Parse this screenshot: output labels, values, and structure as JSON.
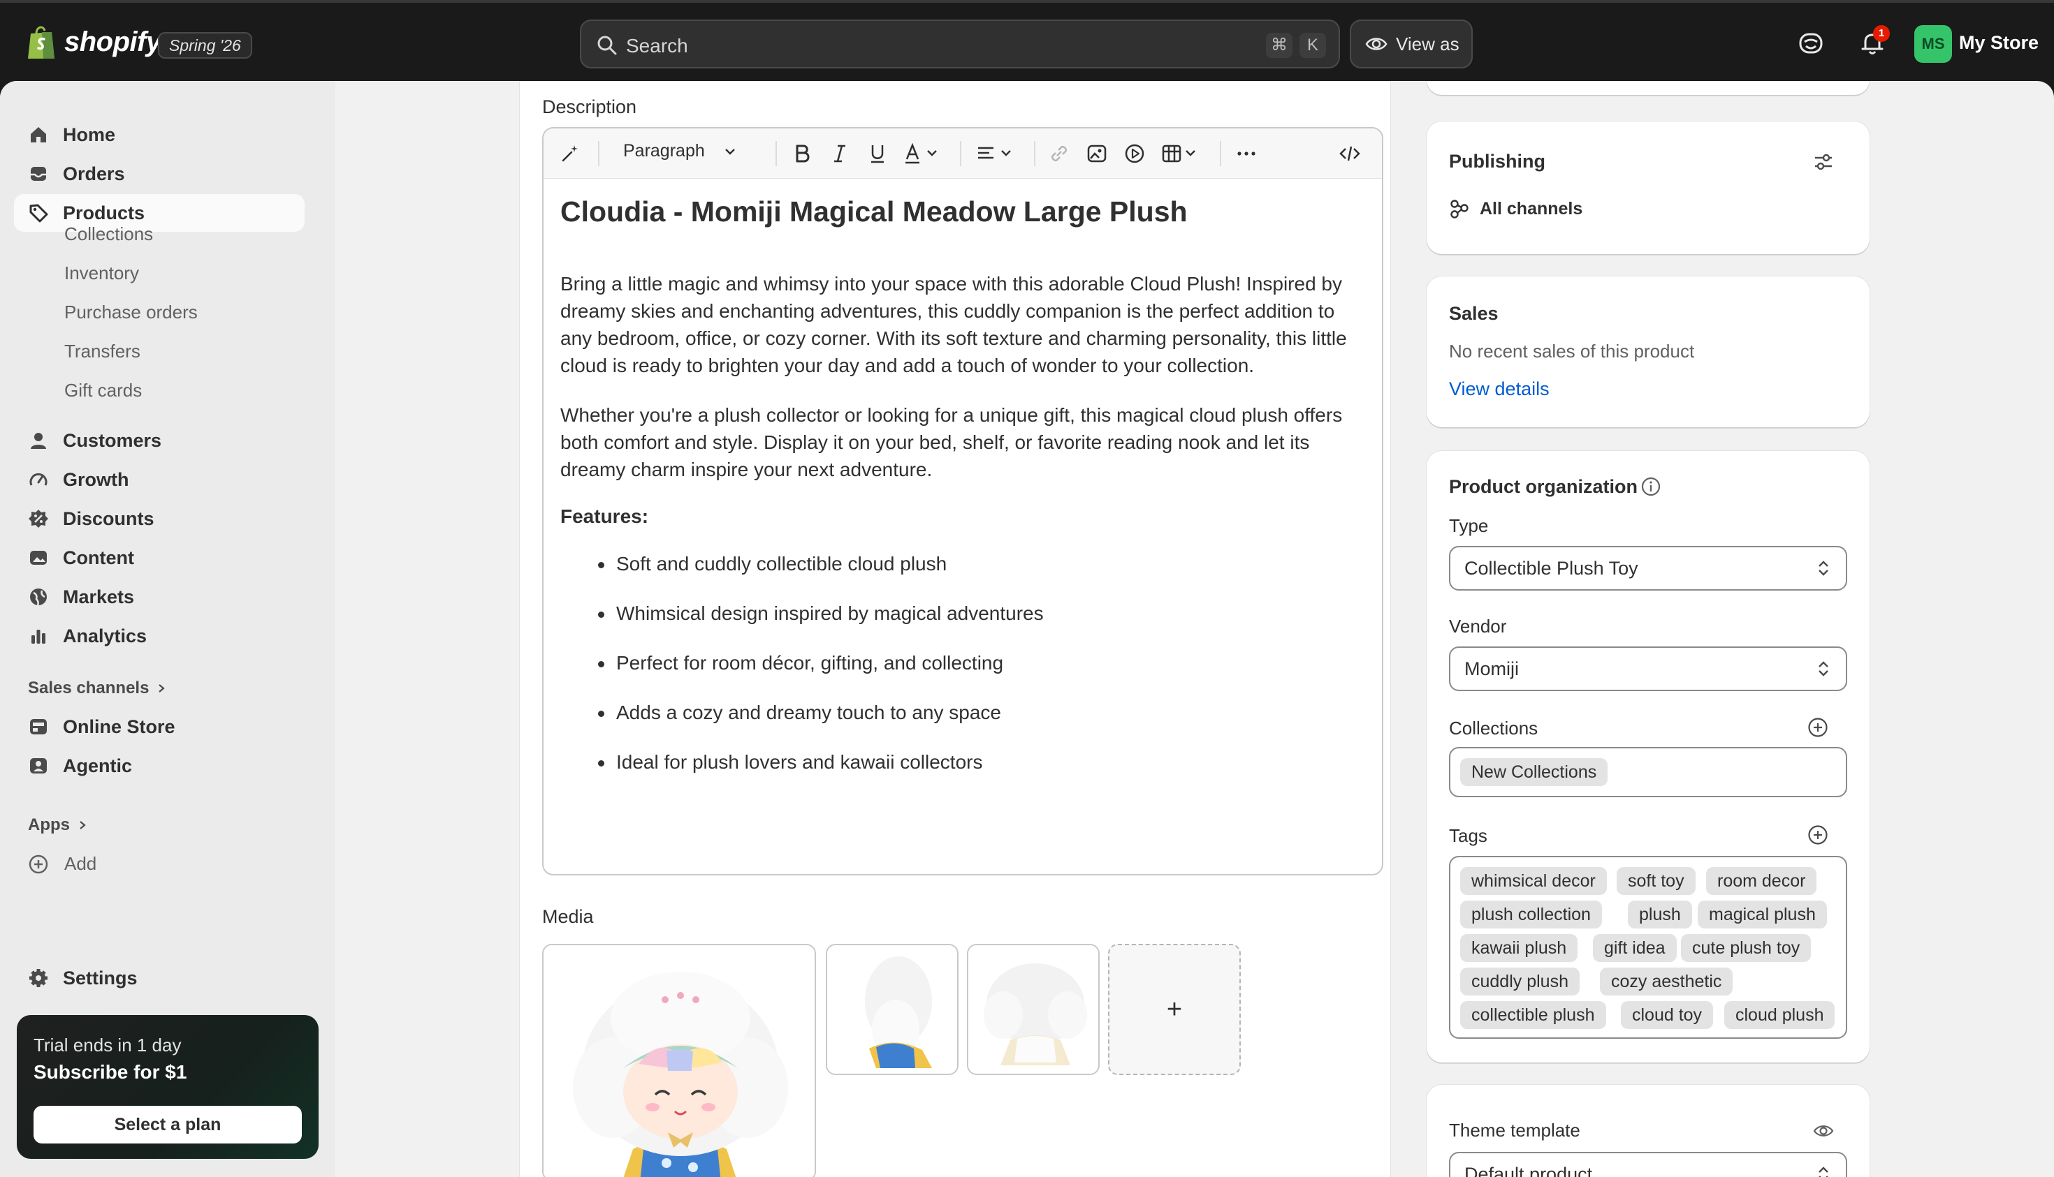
{
  "topbar": {
    "logo_text": "shopify",
    "release_badge": "Spring '26",
    "search_placeholder": "Search",
    "shortcut_cmd": "⌘",
    "shortcut_key": "K",
    "view_as_label": "View as",
    "notification_count": "1",
    "avatar_initials": "MS",
    "store_name": "My Store"
  },
  "sidebar": {
    "items": [
      {
        "label": "Home",
        "icon": "home-icon"
      },
      {
        "label": "Orders",
        "icon": "inbox-icon"
      },
      {
        "label": "Products",
        "icon": "tag-icon",
        "active": true
      }
    ],
    "product_subitems": [
      "Collections",
      "Inventory",
      "Purchase orders",
      "Transfers",
      "Gift cards"
    ],
    "items2": [
      {
        "label": "Customers",
        "icon": "person-icon"
      },
      {
        "label": "Growth",
        "icon": "gauge-icon"
      },
      {
        "label": "Discounts",
        "icon": "discount-icon"
      },
      {
        "label": "Content",
        "icon": "image-icon"
      },
      {
        "label": "Markets",
        "icon": "globe-icon"
      },
      {
        "label": "Analytics",
        "icon": "bar-chart-icon"
      }
    ],
    "sales_channels_label": "Sales channels",
    "channels": [
      {
        "label": "Online Store",
        "icon": "store-icon"
      },
      {
        "label": "Agentic",
        "icon": "robot-icon"
      }
    ],
    "apps_label": "Apps",
    "add_label": "Add",
    "settings_label": "Settings",
    "trial": {
      "line1": "Trial ends in 1 day",
      "line2": "Subscribe for $1",
      "button": "Select a plan"
    }
  },
  "description": {
    "label": "Description",
    "paragraph_style": "Paragraph",
    "heading": "Cloudia - Momiji Magical Meadow Large Plush",
    "para1": "Bring a little magic and whimsy into your space with this adorable Cloud Plush! Inspired by dreamy skies and enchanting adventures, this cuddly companion is the perfect addition to any bedroom, office, or cozy corner. With its soft texture and charming personality, this little cloud is ready to brighten your day and add a touch of wonder to your collection.",
    "para2": "Whether you're a plush collector or looking for a unique gift, this magical cloud plush offers both comfort and style. Display it on your bed, shelf, or favorite reading nook and let its dreamy charm inspire your next adventure.",
    "features_heading": "Features:",
    "features": [
      "Soft and cuddly collectible cloud plush",
      "Whimsical design inspired by magical adventures",
      "Perfect for room décor, gifting, and collecting",
      "Adds a cozy and dreamy touch to any space",
      "Ideal for plush lovers and kawaii collectors"
    ]
  },
  "media": {
    "label": "Media",
    "add_symbol": "+"
  },
  "publishing": {
    "title": "Publishing",
    "channels": "All channels"
  },
  "sales": {
    "title": "Sales",
    "text": "No recent sales of this product",
    "link": "View details"
  },
  "organization": {
    "title": "Product organization",
    "type_label": "Type",
    "type_value": "Collectible Plush Toy",
    "vendor_label": "Vendor",
    "vendor_value": "Momiji",
    "collections_label": "Collections",
    "collections": [
      "New Collections"
    ],
    "tags_label": "Tags",
    "tags": [
      [
        "whimsical decor",
        "soft toy",
        "room decor"
      ],
      [
        "plush collection",
        "plush",
        "magical plush"
      ],
      [
        "kawaii plush",
        "gift idea",
        "cute plush toy"
      ],
      [
        "cuddly plush",
        "cozy aesthetic"
      ],
      [
        "collectible plush",
        "cloud toy",
        "cloud plush"
      ]
    ]
  },
  "theme": {
    "title": "Theme template",
    "value": "Default product"
  },
  "colors": {
    "topbar": "#1a1a1a",
    "link": "#005bd3",
    "avatar": "#36c46a"
  }
}
